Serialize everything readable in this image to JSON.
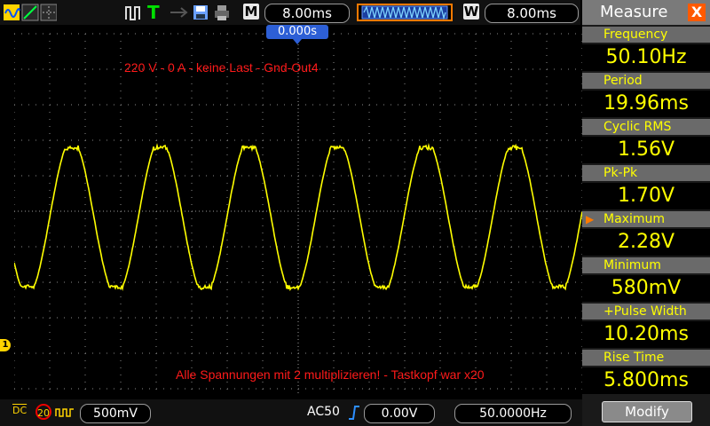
{
  "topbar": {
    "trigger_status": "T",
    "timebase_label": "M",
    "timebase_value": "8.00ms",
    "window_label": "W",
    "window_value": "8.00ms"
  },
  "trigger_position": "0.000s",
  "annotations": {
    "top": "220 V - 0 A - keine Last - Gnd-Out4",
    "bottom": "Alle Spannungen mit 2 multiplizieren! - Tastkopf war x20"
  },
  "measure": {
    "title": "Measure",
    "close": "X",
    "items": [
      {
        "label": "Frequency",
        "value": "50.10Hz"
      },
      {
        "label": "Period",
        "value": "19.96ms"
      },
      {
        "label": "Cyclic RMS",
        "value": "1.56V"
      },
      {
        "label": "Pk-Pk",
        "value": "1.70V"
      },
      {
        "label": "Maximum",
        "value": "2.28V"
      },
      {
        "label": "Minimum",
        "value": "580mV"
      },
      {
        "label": "+Pulse Width",
        "value": "10.20ms"
      },
      {
        "label": "Rise Time",
        "value": "5.800ms"
      }
    ],
    "selected_marker": "▶",
    "modify_label": "Modify"
  },
  "bottombar": {
    "coupling": "DC",
    "probe": "20",
    "volts_div": "500mV",
    "trigger_mode": "AC50",
    "trigger_level": "0.00V",
    "frequency": "50.0000Hz"
  },
  "channel_marker": "1",
  "colors": {
    "trace": "#ffff00",
    "annotation": "#ff1a1a",
    "trigger_label": "#2d5fd6",
    "close_button": "#ff5a00"
  },
  "waveform": {
    "frequency_hz": 50.1,
    "max_v": 2.28,
    "min_v": 0.58,
    "shape": "clipped-sine"
  }
}
